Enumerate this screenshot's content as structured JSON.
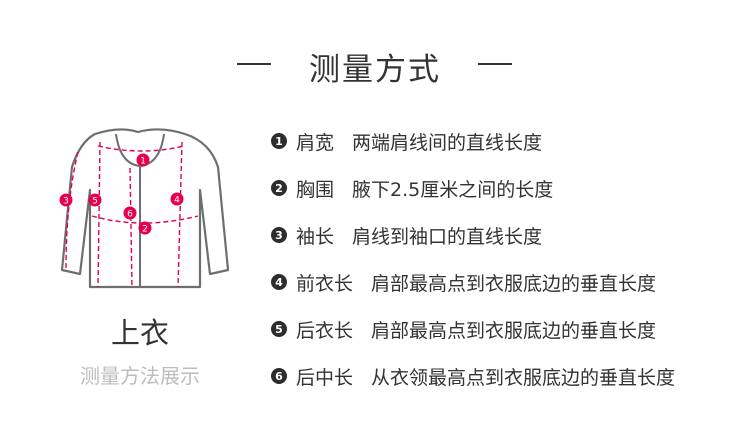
{
  "title": "测量方式",
  "garment": {
    "name": "上衣",
    "subtitle": "测量方法展示"
  },
  "accent_color": "#e6004c",
  "items": [
    {
      "num": "1",
      "name": "肩宽",
      "desc": "两端肩线间的直线长度"
    },
    {
      "num": "2",
      "name": "胸围",
      "desc": "腋下2.5厘米之间的长度"
    },
    {
      "num": "3",
      "name": "袖长",
      "desc": "肩线到袖口的直线长度"
    },
    {
      "num": "4",
      "name": "前衣长",
      "desc": "肩部最高点到衣服底边的垂直长度"
    },
    {
      "num": "5",
      "name": "后衣长",
      "desc": "肩部最高点到衣服底边的垂直长度"
    },
    {
      "num": "6",
      "name": "后中长",
      "desc": "从衣领最高点到衣服底边的垂直长度"
    }
  ]
}
